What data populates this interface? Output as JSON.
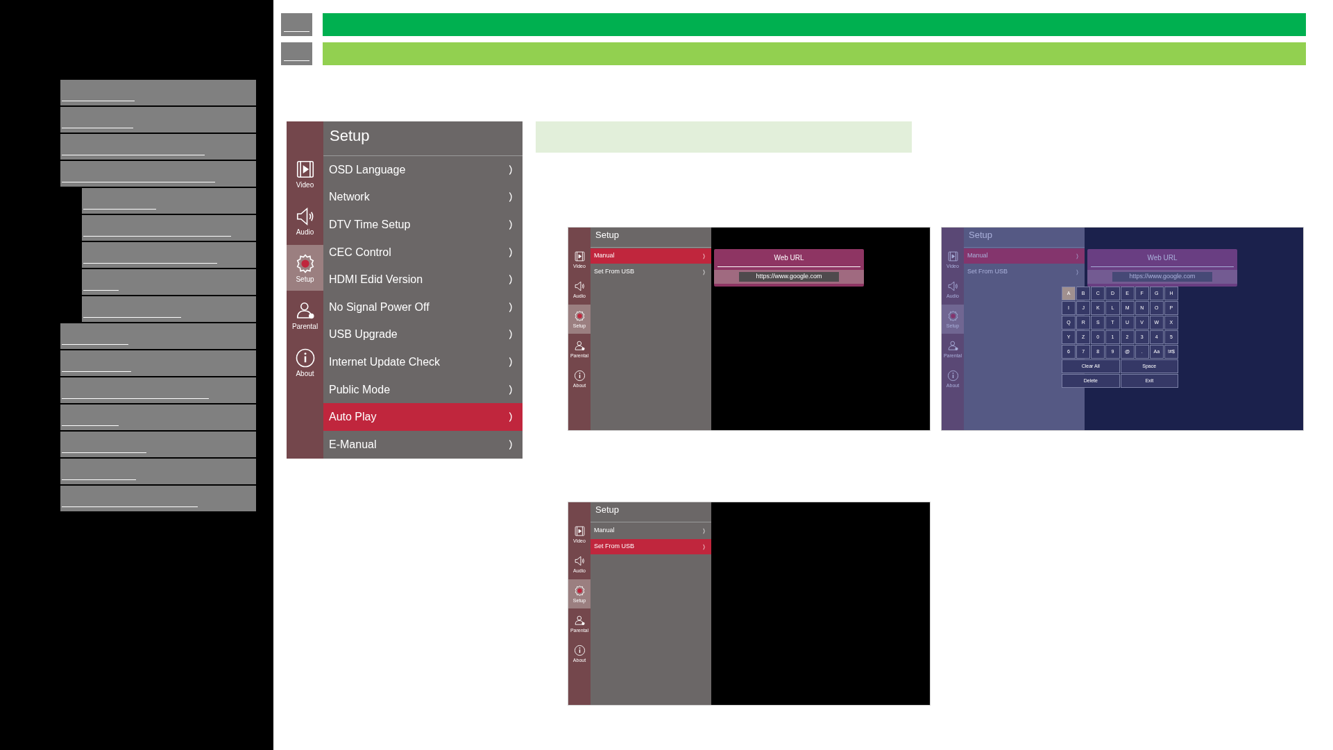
{
  "sidebar": {
    "items": [
      {
        "kind": "link"
      },
      {
        "kind": "link"
      },
      {
        "kind": "link"
      },
      {
        "kind": "link",
        "children": [
          {
            "kind": "link"
          },
          {
            "kind": "link"
          },
          {
            "kind": "link"
          },
          {
            "kind": "link"
          },
          {
            "kind": "link"
          }
        ]
      },
      {
        "kind": "link"
      },
      {
        "kind": "link"
      },
      {
        "kind": "link"
      },
      {
        "kind": "link"
      },
      {
        "kind": "link"
      },
      {
        "kind": "link"
      },
      {
        "kind": "link"
      }
    ]
  },
  "header_rows": [
    {
      "color": "#00b050"
    },
    {
      "color": "#92d050"
    }
  ],
  "setup_menu": {
    "title": "Setup",
    "rail": [
      {
        "label": "Video",
        "selected": false
      },
      {
        "label": "Audio",
        "selected": false
      },
      {
        "label": "Setup",
        "selected": true
      },
      {
        "label": "Parental",
        "selected": false
      },
      {
        "label": "About",
        "selected": false
      }
    ],
    "items": [
      {
        "label": "OSD Language",
        "selected": false
      },
      {
        "label": "Network",
        "selected": false
      },
      {
        "label": "DTV Time Setup",
        "selected": false
      },
      {
        "label": "CEC Control",
        "selected": false
      },
      {
        "label": "HDMI Edid Version",
        "selected": false
      },
      {
        "label": "No Signal Power Off",
        "selected": false
      },
      {
        "label": "USB Upgrade",
        "selected": false
      },
      {
        "label": "Internet Update Check",
        "selected": false
      },
      {
        "label": "Public Mode",
        "selected": false
      },
      {
        "label": "Auto Play",
        "selected": true
      },
      {
        "label": "E-Manual",
        "selected": false
      }
    ]
  },
  "screenshots": [
    {
      "title": "Setup",
      "dimmed": false,
      "rail": [
        {
          "label": "Video",
          "selected": false
        },
        {
          "label": "Audio",
          "selected": false
        },
        {
          "label": "Setup",
          "selected": true
        },
        {
          "label": "Parental",
          "selected": false
        },
        {
          "label": "About",
          "selected": false
        }
      ],
      "items": [
        {
          "label": "Manual",
          "selected": true
        },
        {
          "label": "Set From USB",
          "selected": false
        }
      ],
      "popup": {
        "title": "Web URL",
        "value": "https://www.google.com"
      }
    },
    {
      "title": "Setup",
      "dimmed": true,
      "rail": [
        {
          "label": "Video",
          "selected": false
        },
        {
          "label": "Audio",
          "selected": false
        },
        {
          "label": "Setup",
          "selected": true
        },
        {
          "label": "Parental",
          "selected": false
        },
        {
          "label": "About",
          "selected": false
        }
      ],
      "items": [
        {
          "label": "Manual",
          "selected": true
        },
        {
          "label": "Set From USB",
          "selected": false
        }
      ],
      "popup": {
        "title": "Web URL",
        "value": "https://www.google.com"
      },
      "keyboard": {
        "keys": [
          {
            "label": "A",
            "selected": true
          },
          {
            "label": "B",
            "selected": false
          },
          {
            "label": "C",
            "selected": false
          },
          {
            "label": "D",
            "selected": false
          },
          {
            "label": "E",
            "selected": false
          },
          {
            "label": "F",
            "selected": false
          },
          {
            "label": "G",
            "selected": false
          },
          {
            "label": "H",
            "selected": false
          },
          {
            "label": "I",
            "selected": false
          },
          {
            "label": "J",
            "selected": false
          },
          {
            "label": "K",
            "selected": false
          },
          {
            "label": "L",
            "selected": false
          },
          {
            "label": "M",
            "selected": false
          },
          {
            "label": "N",
            "selected": false
          },
          {
            "label": "O",
            "selected": false
          },
          {
            "label": "P",
            "selected": false
          },
          {
            "label": "Q",
            "selected": false
          },
          {
            "label": "R",
            "selected": false
          },
          {
            "label": "S",
            "selected": false
          },
          {
            "label": "T",
            "selected": false
          },
          {
            "label": "U",
            "selected": false
          },
          {
            "label": "V",
            "selected": false
          },
          {
            "label": "W",
            "selected": false
          },
          {
            "label": "X",
            "selected": false
          },
          {
            "label": "Y",
            "selected": false
          },
          {
            "label": "Z",
            "selected": false
          },
          {
            "label": "0",
            "selected": false
          },
          {
            "label": "1",
            "selected": false
          },
          {
            "label": "2",
            "selected": false
          },
          {
            "label": "3",
            "selected": false
          },
          {
            "label": "4",
            "selected": false
          },
          {
            "label": "5",
            "selected": false
          },
          {
            "label": "6",
            "selected": false
          },
          {
            "label": "7",
            "selected": false
          },
          {
            "label": "8",
            "selected": false
          },
          {
            "label": "9",
            "selected": false
          },
          {
            "label": "@",
            "selected": false
          },
          {
            "label": ".",
            "selected": false
          },
          {
            "label": "Aa",
            "selected": false
          },
          {
            "label": "!#$",
            "selected": false
          }
        ],
        "actions": [
          "Clear All",
          "Space",
          "Delete",
          "Exit"
        ]
      }
    },
    {
      "title": "Setup",
      "dimmed": false,
      "rail": [
        {
          "label": "Video",
          "selected": false
        },
        {
          "label": "Audio",
          "selected": false
        },
        {
          "label": "Setup",
          "selected": true
        },
        {
          "label": "Parental",
          "selected": false
        },
        {
          "label": "About",
          "selected": false
        }
      ],
      "items": [
        {
          "label": "Manual",
          "selected": false
        },
        {
          "label": "Set From USB",
          "selected": true
        }
      ]
    }
  ]
}
